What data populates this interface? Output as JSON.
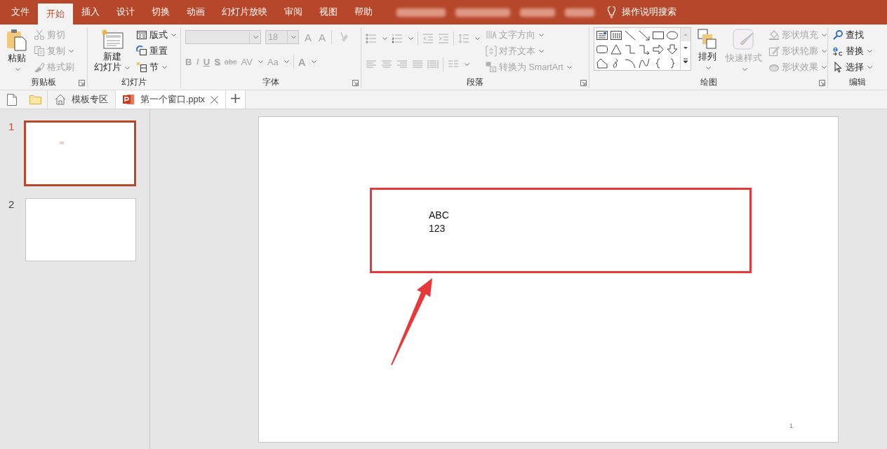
{
  "title_bar": {
    "menu_tabs": [
      {
        "label": "文件",
        "selected": false
      },
      {
        "label": "开始",
        "selected": true
      },
      {
        "label": "插入",
        "selected": false
      },
      {
        "label": "设计",
        "selected": false
      },
      {
        "label": "切换",
        "selected": false
      },
      {
        "label": "动画",
        "selected": false
      },
      {
        "label": "幻灯片放映",
        "selected": false
      },
      {
        "label": "审阅",
        "selected": false
      },
      {
        "label": "视图",
        "selected": false
      },
      {
        "label": "帮助",
        "selected": false
      }
    ],
    "tell_me": "操作说明搜索"
  },
  "ribbon": {
    "groups": [
      {
        "kind": "clipboard",
        "label": "剪贴板",
        "launcher": true,
        "items": [
          {
            "kind": "large",
            "lines": [
              "粘贴"
            ],
            "disabled": false,
            "dropdown": true
          },
          {
            "kind": "small",
            "label": "剪切",
            "disabled": true,
            "dropdown": false
          },
          {
            "kind": "small",
            "label": "复制",
            "disabled": true,
            "dropdown": true
          },
          {
            "kind": "small",
            "label": "格式刷",
            "disabled": true,
            "dropdown": false
          }
        ]
      },
      {
        "kind": "slides",
        "label": "幻灯片",
        "launcher": false,
        "items": [
          {
            "kind": "large",
            "lines": [
              "新建",
              "幻灯片"
            ],
            "disabled": false,
            "dropdown": true
          },
          {
            "kind": "small",
            "label": "版式",
            "disabled": false,
            "dropdown": true
          },
          {
            "kind": "small",
            "label": "重置",
            "disabled": false,
            "dropdown": false
          },
          {
            "kind": "small",
            "label": "节",
            "disabled": false,
            "dropdown": true
          }
        ]
      },
      {
        "kind": "font",
        "label": "字体",
        "launcher": true,
        "font_size": "18",
        "size_buttons": [
          "A",
          "A"
        ],
        "format_buttons": [
          "B",
          "I",
          "U",
          "S",
          "abc",
          "AV",
          "Aa"
        ],
        "color_button": "A"
      },
      {
        "kind": "paragraph",
        "label": "段落",
        "launcher": true,
        "items": [
          {
            "kind": "small",
            "label": "文字方向",
            "disabled": true,
            "dropdown": true
          },
          {
            "kind": "small",
            "label": "对齐文本",
            "disabled": true,
            "dropdown": true
          },
          {
            "kind": "small",
            "label": "转换为 SmartArt",
            "disabled": true,
            "dropdown": true
          }
        ]
      },
      {
        "kind": "drawing",
        "label": "绘图",
        "launcher": true,
        "items": [
          {
            "kind": "large",
            "lines": [
              "排列"
            ],
            "disabled": false,
            "dropdown": true
          },
          {
            "kind": "large",
            "lines": [
              "快速样式"
            ],
            "disabled": true,
            "dropdown": true
          },
          {
            "kind": "small",
            "label": "形状填充",
            "disabled": true,
            "dropdown": true
          },
          {
            "kind": "small",
            "label": "形状轮廓",
            "disabled": true,
            "dropdown": true
          },
          {
            "kind": "small",
            "label": "形状效果",
            "disabled": true,
            "dropdown": true
          }
        ]
      },
      {
        "kind": "editing",
        "label": "编辑",
        "launcher": false,
        "items": [
          {
            "kind": "small",
            "label": "查找",
            "disabled": false,
            "dropdown": false
          },
          {
            "kind": "small",
            "label": "替换",
            "disabled": false,
            "dropdown": true
          },
          {
            "kind": "small",
            "label": "选择",
            "disabled": false,
            "dropdown": true
          }
        ]
      }
    ]
  },
  "document_tabs": [
    {
      "kind": "home",
      "label": "模板专区",
      "selected": false
    },
    {
      "kind": "file",
      "label": "第一个窗口.pptx",
      "selected": true
    }
  ],
  "thumbnails": [
    {
      "number": "1",
      "selected": true
    },
    {
      "number": "2",
      "selected": false
    }
  ],
  "slide": {
    "text_lines": [
      "ABC",
      "123"
    ],
    "page_number": "1"
  }
}
